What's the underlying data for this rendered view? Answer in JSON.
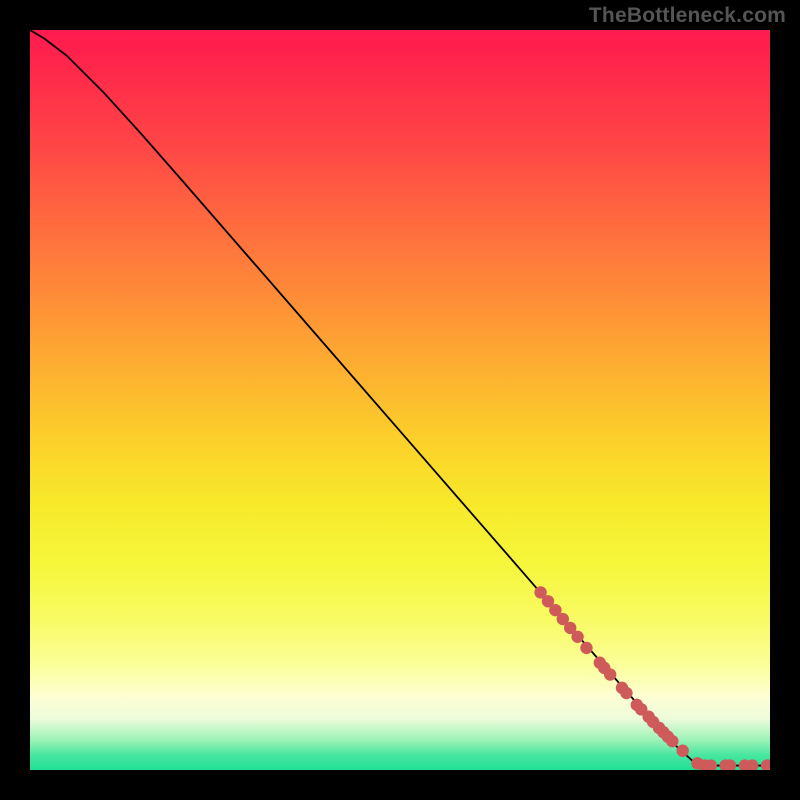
{
  "watermark": "TheBottleneck.com",
  "chart_data": {
    "type": "line",
    "title": "",
    "xlabel": "",
    "ylabel": "",
    "xlim": [
      0,
      100
    ],
    "ylim": [
      0,
      100
    ],
    "curve": [
      [
        0,
        100
      ],
      [
        2,
        98.8
      ],
      [
        5,
        96.5
      ],
      [
        10,
        91.5
      ],
      [
        15,
        86.0
      ],
      [
        20,
        80.3
      ],
      [
        30,
        68.8
      ],
      [
        40,
        57.3
      ],
      [
        50,
        45.8
      ],
      [
        60,
        34.3
      ],
      [
        70,
        22.8
      ],
      [
        80,
        11.3
      ],
      [
        86,
        4.5
      ],
      [
        88,
        2.6
      ],
      [
        89.8,
        1.0
      ],
      [
        91,
        0.6
      ],
      [
        100,
        0.6
      ]
    ],
    "marker_series": {
      "name": "markers",
      "color": "#cf5a5a",
      "points": [
        [
          69.0,
          24.0
        ],
        [
          70.0,
          22.8
        ],
        [
          71.0,
          21.6
        ],
        [
          72.0,
          20.4
        ],
        [
          73.0,
          19.2
        ],
        [
          74.0,
          18.0
        ],
        [
          75.2,
          16.5
        ],
        [
          77.0,
          14.5
        ],
        [
          77.6,
          13.8
        ],
        [
          78.4,
          12.9
        ],
        [
          80.0,
          11.1
        ],
        [
          80.6,
          10.4
        ],
        [
          82.0,
          8.8
        ],
        [
          82.6,
          8.2
        ],
        [
          83.6,
          7.2
        ],
        [
          84.2,
          6.5
        ],
        [
          85.0,
          5.7
        ],
        [
          85.6,
          5.1
        ],
        [
          86.2,
          4.5
        ],
        [
          86.8,
          3.9
        ],
        [
          88.2,
          2.6
        ],
        [
          90.2,
          0.9
        ],
        [
          91.2,
          0.6
        ],
        [
          92.0,
          0.6
        ],
        [
          94.0,
          0.6
        ],
        [
          94.6,
          0.6
        ],
        [
          96.6,
          0.6
        ],
        [
          97.6,
          0.6
        ],
        [
          99.6,
          0.6
        ],
        [
          100.0,
          0.6
        ]
      ],
      "radius_px": 6.2
    }
  }
}
